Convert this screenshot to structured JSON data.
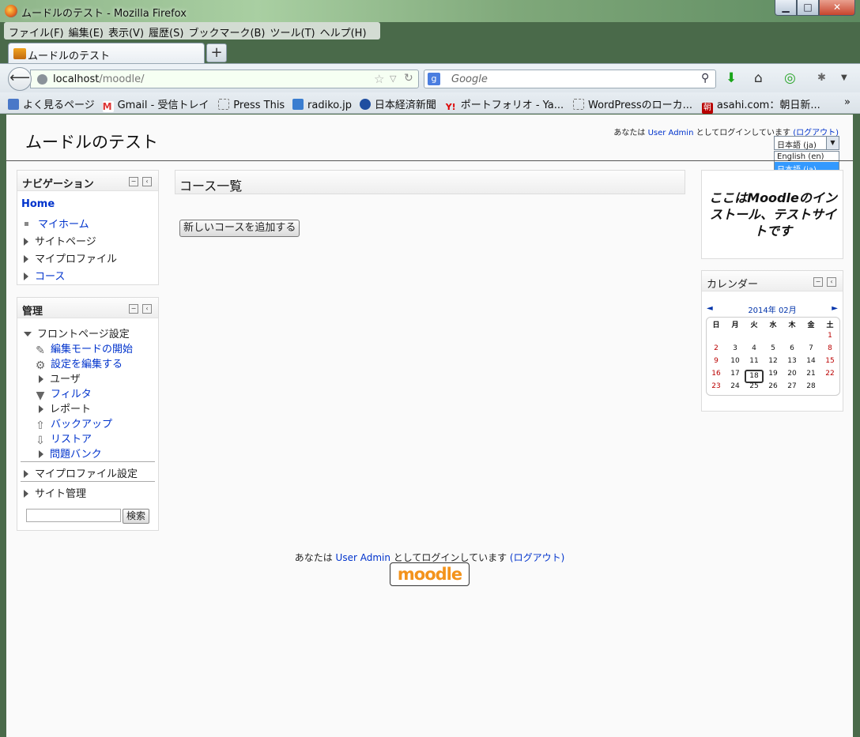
{
  "window": {
    "title": "ムードルのテスト - Mozilla Firefox",
    "min": "▁",
    "max": "□",
    "close": "✕"
  },
  "menubar": [
    "ファイル(F)",
    "編集(E)",
    "表示(V)",
    "履歴(S)",
    "ブックマーク(B)",
    "ツール(T)",
    "ヘルプ(H)"
  ],
  "tab": {
    "label": "ムードルのテスト",
    "new_tab": "+"
  },
  "urlbar": {
    "host": "localhost",
    "path": "/moodle/"
  },
  "search": {
    "engine": "g",
    "placeholder": "Google"
  },
  "bookmarks": [
    "よく見るページ",
    "Gmail - 受信トレイ",
    "Press This",
    "radiko.jp",
    "日本経済新聞",
    "ポートフォリオ - Ya...",
    "WordPressのローカ...",
    "asahi.com：朝日新..."
  ],
  "bookmarks_more": "»",
  "site": {
    "title": "ムードルのテスト",
    "login_prefix": "あなたは",
    "user": "User Admin",
    "login_suffix": "としてログインしています",
    "logout": "(ログアウト)",
    "lang_selected": "日本語 (ja)",
    "lang_options": [
      "English (en)",
      "日本語 (ja)"
    ]
  },
  "navigation": {
    "title": "ナビゲーション",
    "home": "Home",
    "items": [
      "マイホーム",
      "サイトページ",
      "マイプロファイル",
      "コース"
    ]
  },
  "admin": {
    "title": "管理",
    "frontpage": "フロントページ設定",
    "items": [
      "編集モードの開始",
      "設定を編集する",
      "ユーザ",
      "フィルタ",
      "レポート",
      "バックアップ",
      "リストア",
      "問題バンク"
    ],
    "profile_settings": "マイプロファイル設定",
    "site_admin": "サイト管理",
    "search_button": "検索"
  },
  "main": {
    "heading": "コース一覧",
    "add_course": "新しいコースを追加する"
  },
  "intro": {
    "text": "ここはMoodleのインストール、テストサイトです"
  },
  "calendar": {
    "title": "カレンダー",
    "prev": "◄",
    "next": "►",
    "month": "2014年 02月",
    "days": [
      "日",
      "月",
      "火",
      "水",
      "木",
      "金",
      "土"
    ],
    "weeks": [
      [
        "",
        "",
        "",
        "",
        "",
        "",
        "1"
      ],
      [
        "2",
        "3",
        "4",
        "5",
        "6",
        "7",
        "8"
      ],
      [
        "9",
        "10",
        "11",
        "12",
        "13",
        "14",
        "15"
      ],
      [
        "16",
        "17",
        "18",
        "19",
        "20",
        "21",
        "22"
      ],
      [
        "23",
        "24",
        "25",
        "26",
        "27",
        "28",
        ""
      ]
    ],
    "today": "18"
  },
  "footer": {
    "logo": "moodle"
  }
}
